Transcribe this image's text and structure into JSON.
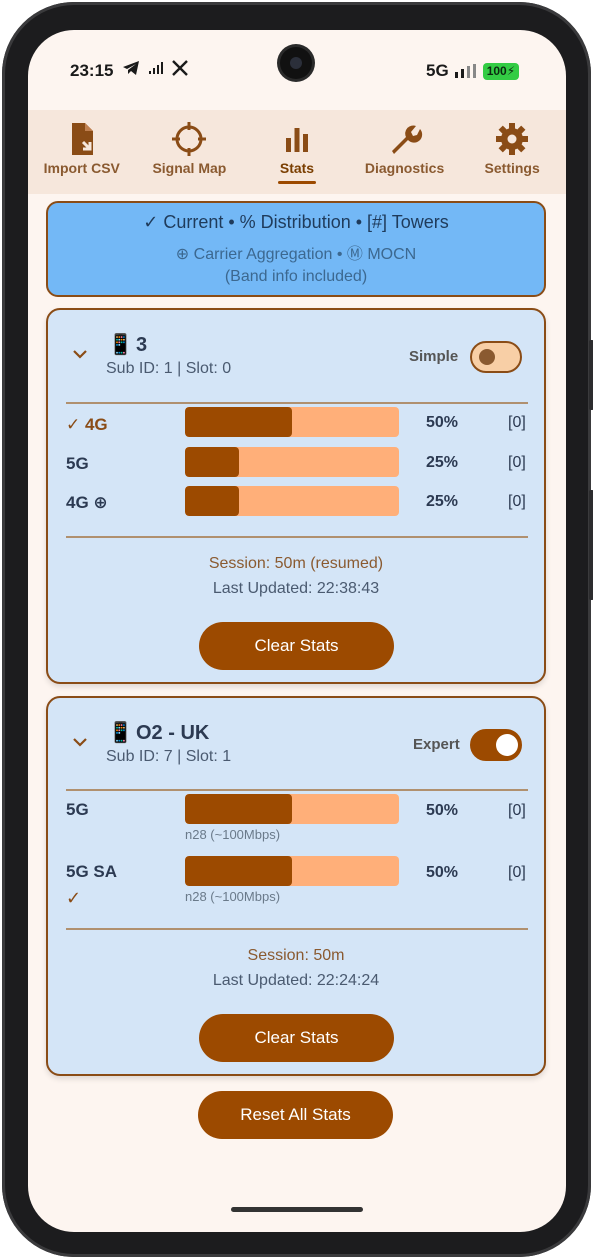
{
  "status_bar": {
    "time": "23:15",
    "network": "5G",
    "battery": "100"
  },
  "tabs": [
    {
      "label": "Import CSV",
      "icon": "file-import-icon",
      "active": false
    },
    {
      "label": "Signal Map",
      "icon": "crosshair-icon",
      "active": false
    },
    {
      "label": "Stats",
      "icon": "bar-chart-icon",
      "active": true
    },
    {
      "label": "Diagnostics",
      "icon": "wrench-icon",
      "active": false
    },
    {
      "label": "Settings",
      "icon": "gear-icon",
      "active": false
    }
  ],
  "legend": {
    "line1": "✓ Current  •  % Distribution  •  [#] Towers",
    "line2": "⊕ Carrier Aggregation  •  Ⓜ MOCN",
    "line3": "(Band info included)"
  },
  "carriers": [
    {
      "emoji": "📱",
      "name": "3",
      "sub_id": "Sub ID: 1 | Slot: 0",
      "mode_label": "Simple",
      "mode_on": false,
      "rows": [
        {
          "label": "✓ 4G",
          "percent": 50,
          "percent_text": "50%",
          "towers": "[0]",
          "active": true
        },
        {
          "label": "5G",
          "percent": 25,
          "percent_text": "25%",
          "towers": "[0]",
          "active": false
        },
        {
          "label": "4G ⊕",
          "percent": 25,
          "percent_text": "25%",
          "towers": "[0]",
          "active": false
        }
      ],
      "session": "Session: 50m (resumed)",
      "last_updated": "Last Updated: 22:38:43",
      "clear_label": "Clear Stats"
    },
    {
      "emoji": "📱",
      "name": "O2 - UK",
      "sub_id": "Sub ID: 7 | Slot: 1",
      "mode_label": "Expert",
      "mode_on": true,
      "rows": [
        {
          "label": "5G",
          "percent": 50,
          "percent_text": "50%",
          "towers": "[0]",
          "band": "n28 (~100Mbps)",
          "active": false
        },
        {
          "label": "5G SA",
          "check": "✓",
          "percent": 50,
          "percent_text": "50%",
          "towers": "[0]",
          "band": "n28 (~100Mbps)",
          "active": true
        }
      ],
      "session": "Session: 50m",
      "last_updated": "Last Updated: 22:24:24",
      "clear_label": "Clear Stats"
    }
  ],
  "reset_label": "Reset All Stats",
  "colors": {
    "primary": "#9c4a00",
    "bar_track": "#ffaf79",
    "card_bg": "#d4e5f7",
    "legend_bg": "#73b8f6"
  }
}
